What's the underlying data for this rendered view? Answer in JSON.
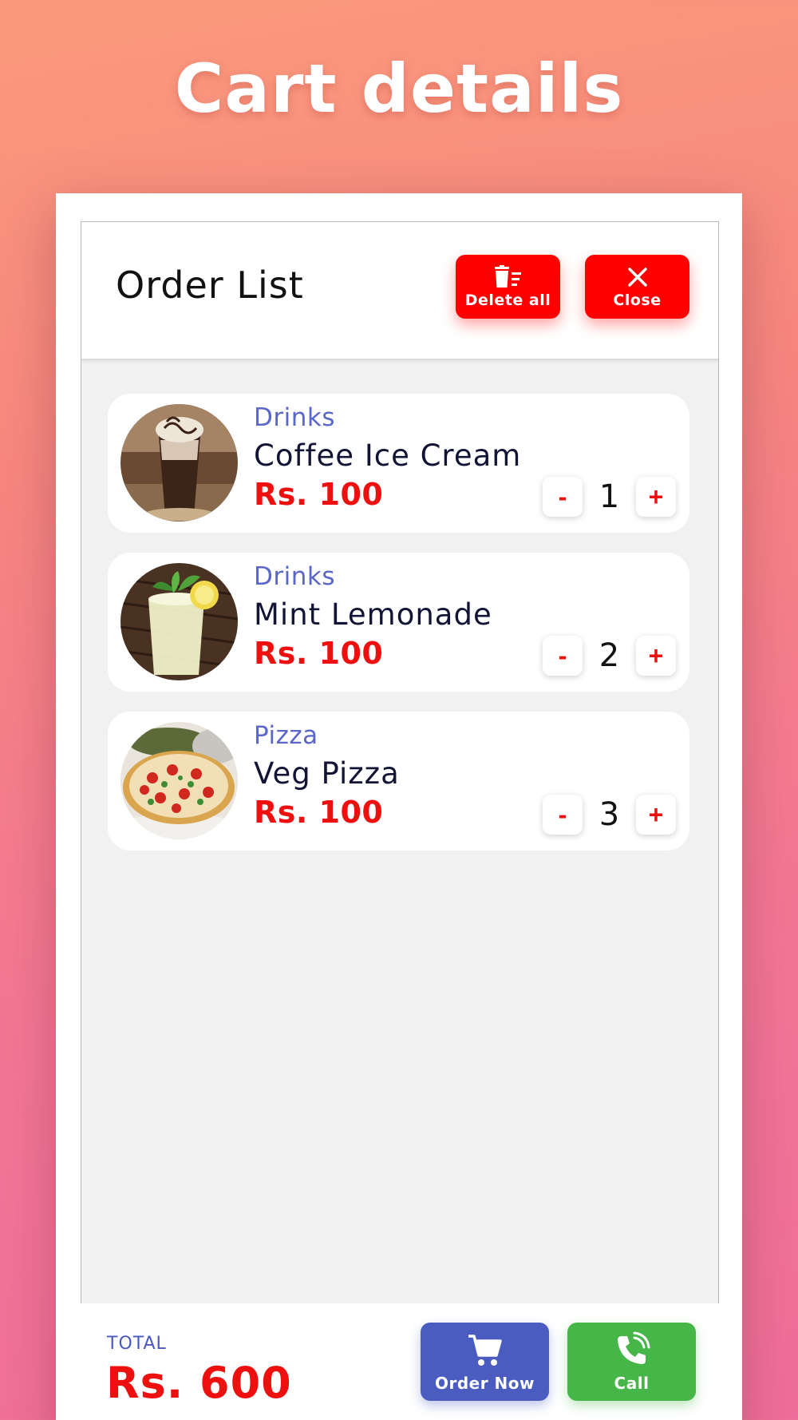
{
  "page": {
    "hero_title": "Cart details"
  },
  "header": {
    "title": "Order List",
    "delete_all_label": "Delete all",
    "close_label": "Close"
  },
  "items": [
    {
      "category": "Drinks",
      "name": "Coffee Ice Cream",
      "price": "Rs. 100",
      "quantity": "1",
      "image": "coffee-ice-cream-image"
    },
    {
      "category": "Drinks",
      "name": "Mint Lemonade",
      "price": "Rs. 100",
      "quantity": "2",
      "image": "mint-lemonade-image"
    },
    {
      "category": "Pizza",
      "name": "Veg Pizza",
      "price": "Rs. 100",
      "quantity": "3",
      "image": "veg-pizza-image"
    }
  ],
  "controls": {
    "minus_label": "-",
    "plus_label": "+"
  },
  "footer": {
    "total_label": "TOTAL",
    "total_value": "Rs. 600",
    "order_now_label": "Order Now",
    "call_label": "Call"
  },
  "colors": {
    "accent_red": "#ff0000",
    "price_red": "#ee0f0f",
    "category_blue": "#5a66c9",
    "order_button_blue": "#4a5cc0",
    "call_button_green": "#47b649"
  },
  "icons": {
    "delete_all": "trash-list-icon",
    "close": "close-icon",
    "order_now": "cart-icon",
    "call": "phone-icon"
  }
}
